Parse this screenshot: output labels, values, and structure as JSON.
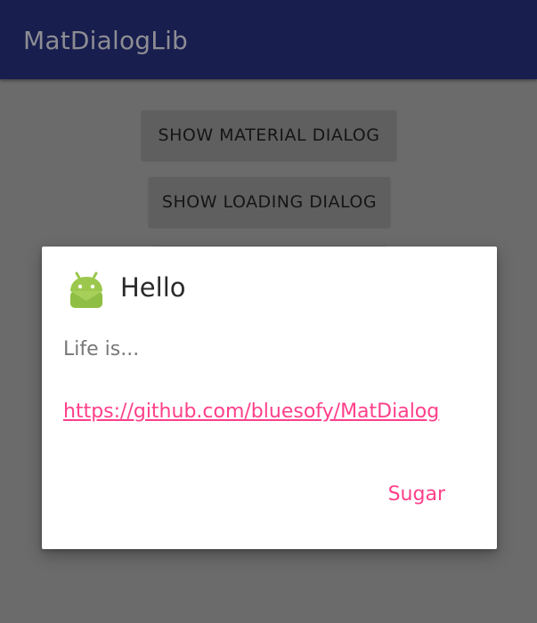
{
  "app_bar": {
    "title": "MatDialogLib"
  },
  "background": {
    "buttons": [
      {
        "label": "SHOW MATERIAL DIALOG"
      },
      {
        "label": "SHOW LOADING DIALOG"
      }
    ]
  },
  "dialog": {
    "icon": "android-robot-icon",
    "title": "Hello",
    "message": "Life is...",
    "link": "https://github.com/bluesofy/MatDialog",
    "action_label": "Sugar"
  },
  "colors": {
    "app_bar": "#181e4e",
    "app_title": "#8d8d93",
    "scrim": "#6b6b6b",
    "button_background": "#5f5f5f",
    "dialog_background": "#ffffff",
    "accent": "#ff3f8a",
    "android_green": "#9bc84c"
  }
}
